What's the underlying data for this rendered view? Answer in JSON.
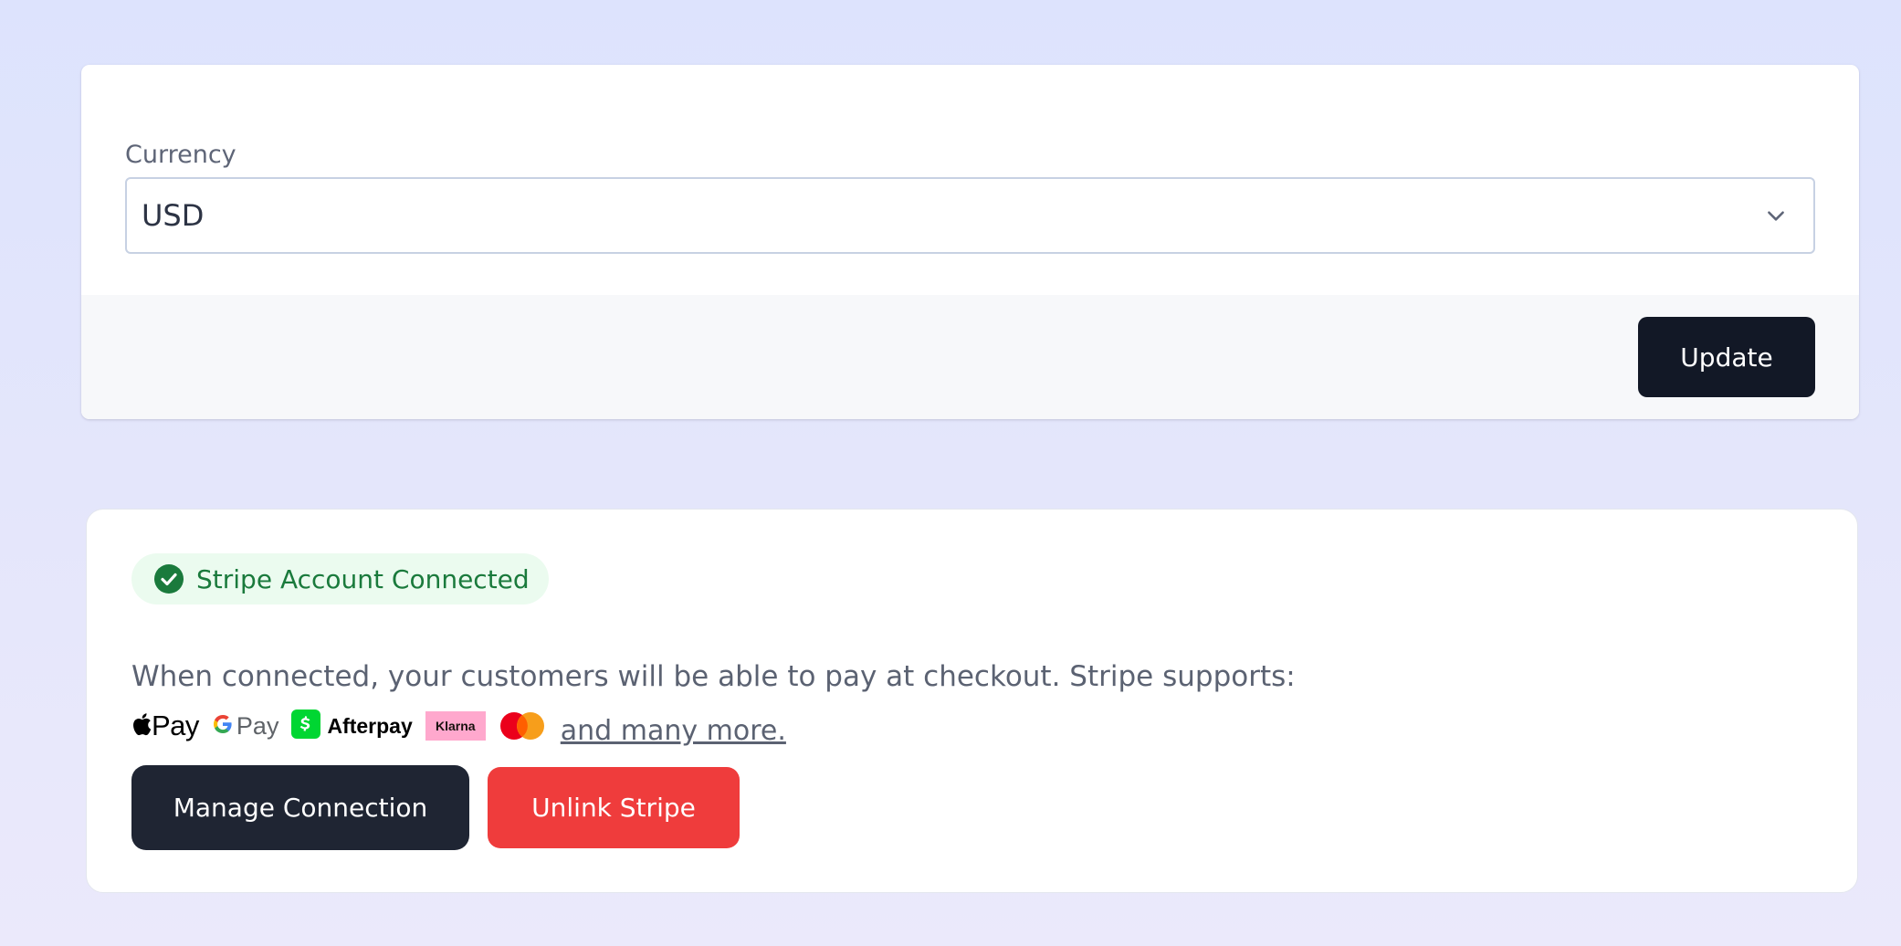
{
  "currency_settings": {
    "label": "Currency",
    "selected_value": "USD",
    "update_label": "Update"
  },
  "stripe": {
    "badge_label": "Stripe Account Connected",
    "description": "When connected, your customers will be able to pay at checkout. Stripe supports:",
    "payment_methods": {
      "apple_pay": "Pay",
      "google_pay": "Pay",
      "afterpay": "Afterpay",
      "klarna": "Klarna"
    },
    "more_link": "and many more.",
    "manage_label": "Manage Connection",
    "unlink_label": "Unlink Stripe"
  },
  "colors": {
    "primary_button": "#121826",
    "danger_button": "#ef3c3c",
    "success_text": "#1a7a3c",
    "success_bg": "#ebfbef",
    "cash_app_green": "#00d632",
    "klarna_pink": "#ffa8cd"
  },
  "icons": {
    "select": "chevron-down-icon",
    "badge": "check-circle-icon",
    "payment_logos": [
      "apple-logo-icon",
      "google-g-icon",
      "cash-app-icon",
      "klarna-logo",
      "mastercard-icon"
    ]
  }
}
